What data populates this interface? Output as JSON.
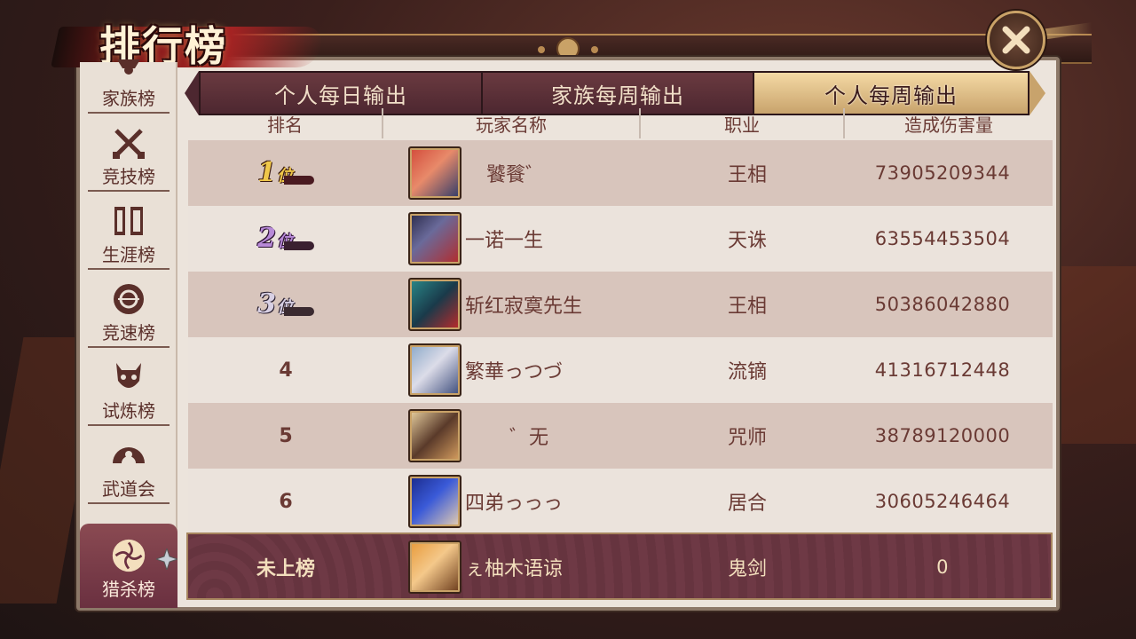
{
  "title": "排行榜",
  "sidebar": {
    "items": [
      {
        "label": "家族榜",
        "icon": "family-icon"
      },
      {
        "label": "竞技榜",
        "icon": "crossed-swords-icon"
      },
      {
        "label": "生涯榜",
        "icon": "scroll-icon"
      },
      {
        "label": "竞速榜",
        "icon": "speed-icon"
      },
      {
        "label": "试炼榜",
        "icon": "demon-mask-icon"
      },
      {
        "label": "武道会",
        "icon": "fan-icon"
      },
      {
        "label": "猎杀榜",
        "icon": "hunt-icon",
        "active": true
      }
    ]
  },
  "tabs": [
    {
      "label": "个人每日输出",
      "active": false
    },
    {
      "label": "家族每周输出",
      "active": false
    },
    {
      "label": "个人每周输出",
      "active": true
    }
  ],
  "table": {
    "columns": [
      "排名",
      "玩家名称",
      "职业",
      "造成伤害量"
    ],
    "rows": [
      {
        "rank": "1",
        "rank_suffix": "位",
        "name": "饕餮゛",
        "job": "王相",
        "damage": "73905209344",
        "rank_color": "#f0c84a"
      },
      {
        "rank": "2",
        "rank_suffix": "位",
        "name": "一诺一生",
        "job": "天诛",
        "damage": "63554453504",
        "rank_color": "#b88ad8"
      },
      {
        "rank": "3",
        "rank_suffix": "位",
        "name": "斩红寂寞先生",
        "job": "王相",
        "damage": "50386042880",
        "rank_color": "#c8c0d8"
      },
      {
        "rank": "4",
        "name": "繁華っつづ",
        "job": "流镝",
        "damage": "41316712448"
      },
      {
        "rank": "5",
        "name": "゛无",
        "job": "咒师",
        "damage": "38789120000"
      },
      {
        "rank": "6",
        "name": "四弟っっっ",
        "job": "居合",
        "damage": "30605246464"
      }
    ]
  },
  "my_row": {
    "rank": "未上榜",
    "name": "ぇ柚木语谅",
    "job": "鬼剑",
    "damage": "0"
  },
  "colors": {
    "panel_bg": "#ece4dc",
    "row_dark": "#d8c5bc",
    "row_light": "#ebe3dc",
    "tab_active": "#e2c58e",
    "tab_inactive": "#5a2f38",
    "text_main": "#6a3a34",
    "accent_gold": "#c9a267"
  }
}
